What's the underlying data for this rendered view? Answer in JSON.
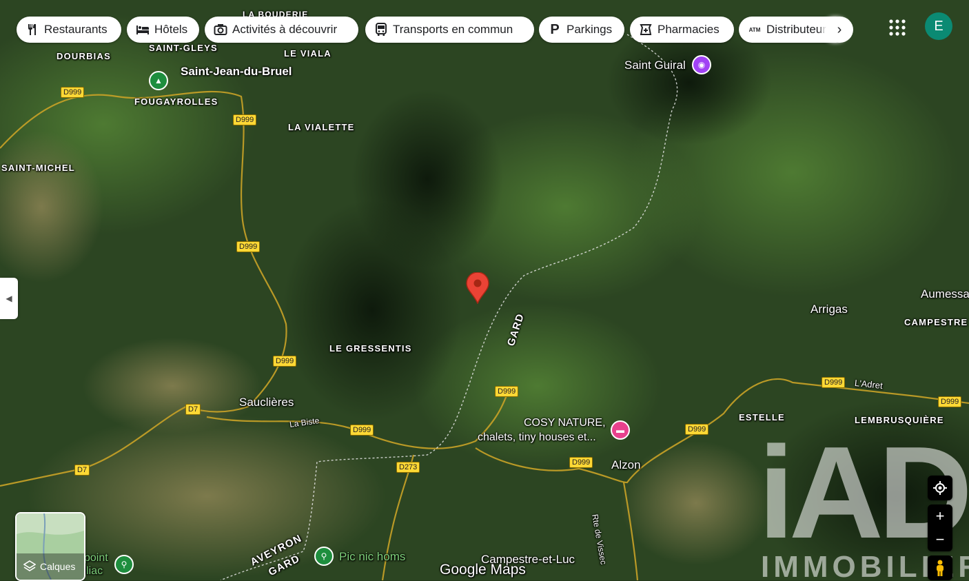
{
  "filters": [
    {
      "label": "Restaurants",
      "icon": "fork-knife-icon"
    },
    {
      "label": "Hôtels",
      "icon": "bed-icon"
    },
    {
      "label": "Activités à découvrir",
      "icon": "camera-icon"
    },
    {
      "label": "Transports en commun",
      "icon": "bus-icon"
    },
    {
      "label": "Parkings",
      "icon": "parking-icon"
    },
    {
      "label": "Pharmacies",
      "icon": "pharmacy-icon"
    },
    {
      "label": "Distributeurs",
      "icon": "atm-icon"
    }
  ],
  "atm_icon_text": "ATM",
  "avatar_letter": "E",
  "layers_label": "Calques",
  "attribution": "Google Maps",
  "watermark": {
    "top": "iAD",
    "bottom": "IMMOBILIER"
  },
  "places": {
    "saint_jean": "Saint-Jean-du-Bruel",
    "saint_gleys": "SAINT-GLEYS",
    "le_viala": "LE VIALA",
    "dourbias": "DOURBIAS",
    "fougayrolles": "FOUGAYROLLES",
    "la_vialette": "LA VIALETTE",
    "saint_michel": "SAINT-MICHEL",
    "la_bouderie": "LA BOUDERIE",
    "le_gressentis": "LE GRESSENTIS",
    "sauclieres": "Sauclières",
    "la_biste": "La Biste",
    "arrigas": "Arrigas",
    "aumessas": "Aumessas",
    "campestre": "CAMPESTRE",
    "estelle": "ESTELLE",
    "ladret": "L'Adret",
    "lembrusquiere": "LEMBRUSQUIÈRE",
    "alzon": "Alzon",
    "campestre_luc": "Campestre-et-Luc",
    "rte_vissec": "Rte de Vissec",
    "aveyron": "AVEYRON",
    "gard": "GARD",
    "gard2": "GARD"
  },
  "pois": {
    "saint_guiral": "Saint Guiral",
    "cosy_line1": "COSY NATURE,",
    "cosy_line2": "chalets, tiny houses et...",
    "pic_nic": "Pic nic homs",
    "point_line1": "point",
    "point_line2": "illiac"
  },
  "roads": [
    "D999",
    "D999",
    "D999",
    "D999",
    "D999",
    "D999",
    "D999",
    "D999",
    "D999",
    "D999",
    "D7",
    "D7",
    "D273"
  ],
  "colors": {
    "marker": "#ea4335",
    "hotel": "#e8418d",
    "activity": "#a142f4",
    "park": "#1e8e3e",
    "road": "#fdd835"
  }
}
